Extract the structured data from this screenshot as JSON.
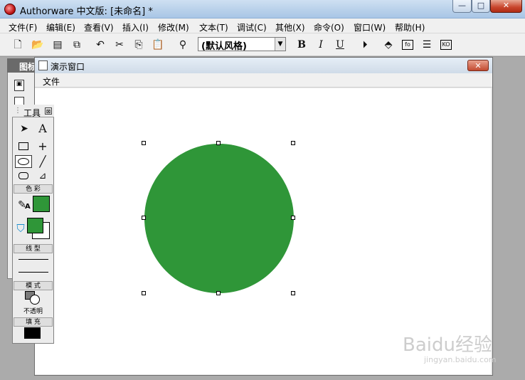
{
  "app": {
    "title": "Authorware 中文版: [未命名] *",
    "window_buttons": {
      "minimize": "—",
      "maximize": "□",
      "close": "✕"
    }
  },
  "menu": [
    "文件(F)",
    "编辑(E)",
    "查看(V)",
    "插入(I)",
    "修改(M)",
    "文本(T)",
    "调试(C)",
    "其他(X)",
    "命令(O)",
    "窗口(W)",
    "帮助(H)"
  ],
  "toolbar": {
    "style_select": "(默认风格)",
    "bold": "B",
    "italic": "I",
    "underline": "U"
  },
  "icon_palette": {
    "title": "图标"
  },
  "presentation_window": {
    "title": "演示窗口",
    "menu_file": "文件",
    "close_glyph": "✕",
    "shape": {
      "kind": "circle",
      "fill": "#2f9638"
    }
  },
  "tool_palette": {
    "title": "工具",
    "close_glyph": "⊠",
    "sections": {
      "color": "色 彩",
      "line": "线 型",
      "mode": "模 式",
      "fill": "填 充"
    },
    "mode_label": "不透明",
    "colors": {
      "foreground": "#2f9638",
      "fill": "#000000"
    }
  },
  "watermark": {
    "text": "Baidu经验",
    "url": "jingyan.baidu.com"
  }
}
